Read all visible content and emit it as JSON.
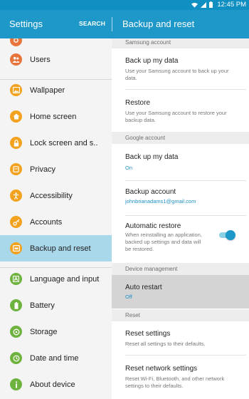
{
  "status_bar": {
    "time": "12:45 PM"
  },
  "app_bar": {
    "title": "Settings",
    "search_label": "SEARCH",
    "panel_title": "Backup and reset"
  },
  "sidebar": {
    "items": [
      {
        "label": "",
        "icon": "general-icon",
        "color": "#e8743b"
      },
      {
        "label": "Users",
        "icon": "users-icon",
        "color": "#e8743b"
      },
      {
        "label": "Wallpaper",
        "icon": "wallpaper-icon",
        "color": "#f2a21e"
      },
      {
        "label": "Home screen",
        "icon": "home-icon",
        "color": "#f2a21e"
      },
      {
        "label": "Lock screen and s..",
        "icon": "lock-icon",
        "color": "#f2a21e"
      },
      {
        "label": "Privacy",
        "icon": "privacy-icon",
        "color": "#f2a21e"
      },
      {
        "label": "Accessibility",
        "icon": "accessibility-icon",
        "color": "#f2a21e"
      },
      {
        "label": "Accounts",
        "icon": "key-icon",
        "color": "#f2a21e"
      },
      {
        "label": "Backup and reset",
        "icon": "backup-icon",
        "color": "#f2a21e"
      },
      {
        "label": "Language and input",
        "icon": "language-icon",
        "color": "#6fb33f"
      },
      {
        "label": "Battery",
        "icon": "battery-icon",
        "color": "#6fb33f"
      },
      {
        "label": "Storage",
        "icon": "storage-icon",
        "color": "#6fb33f"
      },
      {
        "label": "Date and time",
        "icon": "clock-icon",
        "color": "#6fb33f"
      },
      {
        "label": "About device",
        "icon": "info-icon",
        "color": "#6fb33f"
      }
    ],
    "selected": "Backup and reset"
  },
  "panel": {
    "samsung_header": "Samsung account",
    "backup_title": "Back up my data",
    "backup_sub": "Use your Samsung account to back up your data.",
    "restore_title": "Restore",
    "restore_sub": "Use your Samsung account to restore your backup data.",
    "google_header": "Google account",
    "gbackup_title": "Back up my data",
    "gbackup_sub": "On",
    "baccount_title": "Backup account",
    "baccount_sub": "johnbrianadams1@gmail.com",
    "autorestore_title": "Automatic restore",
    "autorestore_sub": "When reinstalling an application, backed up settings and data will be restored.",
    "autorestore_on": true,
    "device_header": "Device management",
    "autorestart_title": "Auto restart",
    "autorestart_sub": "Off",
    "reset_header": "Reset",
    "resetsettings_title": "Reset settings",
    "resetsettings_sub": "Reset all settings to their defaults.",
    "resetnetwork_title": "Reset network settings",
    "resetnetwork_sub": "Reset Wi-Fi, Bluetooth, and other network settings to their defaults."
  },
  "colors": {
    "status_bar": "#0f8fc2",
    "app_bar": "#1e98c9",
    "selected_row": "#aad8eb",
    "accent": "#1e90c8"
  }
}
